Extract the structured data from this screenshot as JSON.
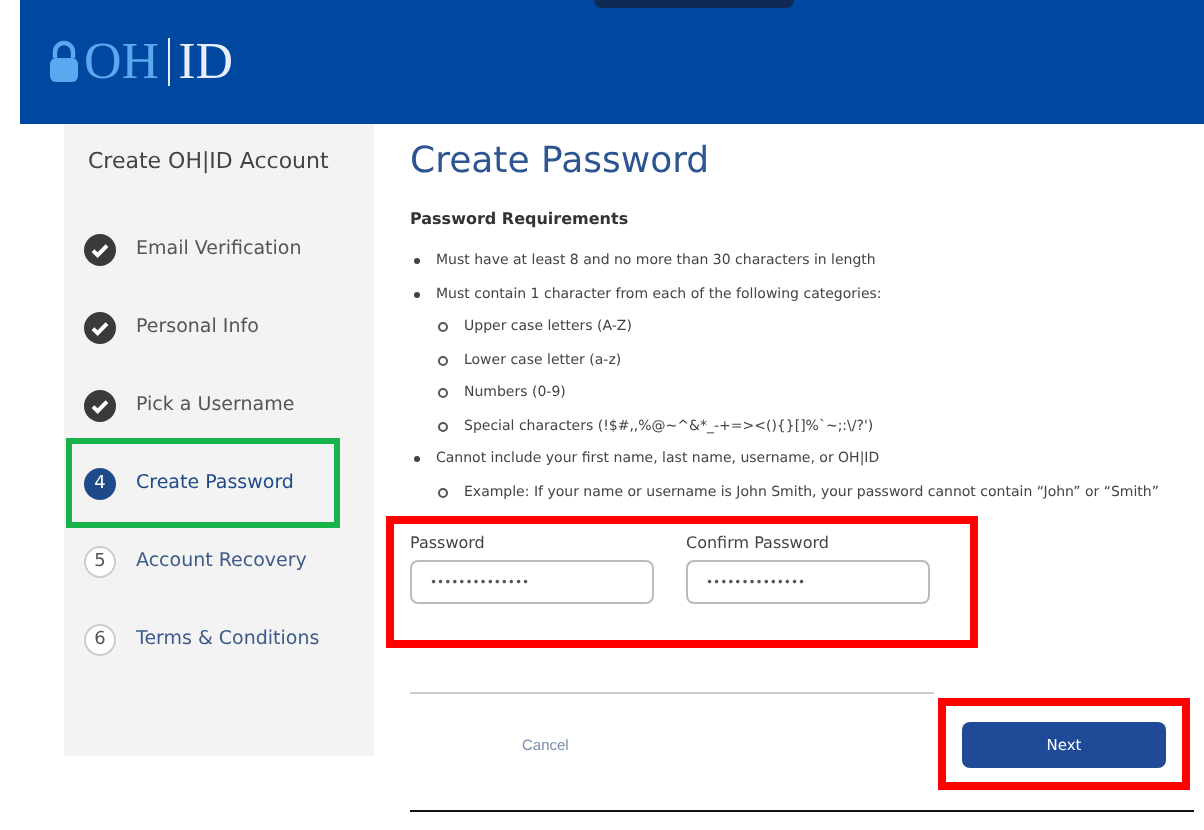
{
  "header": {
    "logo_left": "OH",
    "logo_right": "ID"
  },
  "sidebar": {
    "title": "Create OH|ID Account",
    "steps": [
      {
        "label": "Email Verification",
        "kind": "done",
        "selected": false
      },
      {
        "label": "Personal Info",
        "kind": "done",
        "selected": false
      },
      {
        "label": "Pick a Username",
        "kind": "done",
        "selected": false
      },
      {
        "number": "4",
        "label": "Create Password",
        "kind": "current",
        "selected": true
      },
      {
        "number": "5",
        "label": "Account Recovery",
        "kind": "pending",
        "selected": false
      },
      {
        "number": "6",
        "label": "Terms & Conditions",
        "kind": "pending",
        "selected": false
      }
    ]
  },
  "main": {
    "title": "Create Password",
    "requirements_heading": "Password Requirements",
    "requirements": [
      {
        "text": "Must have at least 8 and no more than 30 characters in length"
      },
      {
        "text": "Must contain 1 character from each of the following categories:",
        "children": [
          {
            "text": "Upper case letters (A-Z)"
          },
          {
            "text": "Lower case letter (a-z)"
          },
          {
            "text": "Numbers (0-9)"
          },
          {
            "text": "Special characters (!$#,,%@~^&*_-+=><(){}[]%`~;:\\/?')"
          }
        ]
      },
      {
        "text": "Cannot include your first name, last name, username, or OH|ID",
        "children": [
          {
            "text": "Example: If your name or username is John Smith, your password cannot contain “John” or “Smith”"
          }
        ]
      }
    ],
    "fields_highlighted": true,
    "fields": [
      {
        "label": "Password",
        "value": "••••••••••••••"
      },
      {
        "label": "Confirm Password",
        "value": "••••••••••••••"
      }
    ],
    "cancel": "Cancel",
    "next": {
      "label": "Next",
      "highlighted": true
    }
  }
}
